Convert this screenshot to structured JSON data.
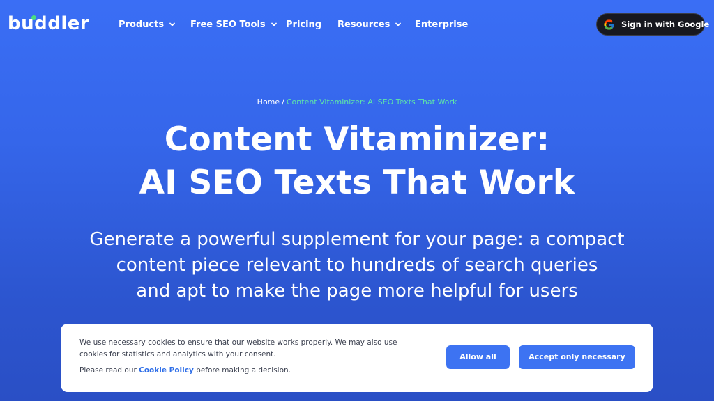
{
  "header": {
    "logo": "buddler",
    "nav": [
      {
        "label": "Products",
        "has_dropdown": true
      },
      {
        "label": "Free SEO Tools",
        "has_dropdown": true
      },
      {
        "label": "Pricing",
        "has_dropdown": false
      },
      {
        "label": "Resources",
        "has_dropdown": true
      },
      {
        "label": "Enterprise",
        "has_dropdown": false
      }
    ],
    "signin_label": "Sign in with Google"
  },
  "breadcrumb": {
    "home": "Home",
    "separator": "/",
    "current": "Content Vitaminizer: AI SEO Texts That Work"
  },
  "hero": {
    "title_line1": "Content Vitaminizer:",
    "title_line2": "AI SEO Texts That Work",
    "subtitle_line1": "Generate a powerful supplement for your page: a compact",
    "subtitle_line2": "content piece relevant to hundreds of search queries",
    "subtitle_line3": "and apt to make the page more helpful for users"
  },
  "cookie_banner": {
    "line1": "We use necessary cookies to ensure that our website works properly. We may also use",
    "line2": "cookies for statistics and analytics with your consent.",
    "policy_prefix": "Please read our",
    "policy_link": "Cookie Policy",
    "policy_suffix": "before making a decision.",
    "allow_all": "Allow all",
    "accept_necessary": "Accept only necessary"
  },
  "colors": {
    "background_top": "#3a6ef5",
    "background_bottom": "#2a4fc5",
    "accent_green": "#5ee6a8",
    "button_blue": "#3d73f2",
    "signin_bg": "#17181f"
  },
  "icons": {
    "dropdown": "chevron-down-icon",
    "google": "google-icon"
  }
}
